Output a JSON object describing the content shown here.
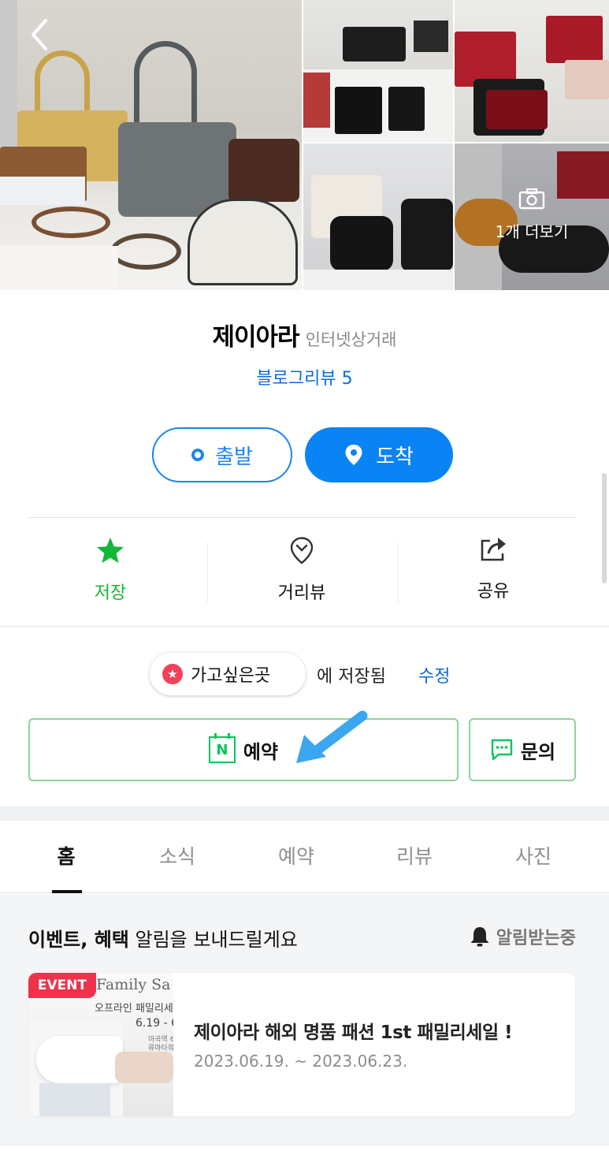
{
  "gallery": {
    "more_label": "1개 더보기"
  },
  "place": {
    "name": "제이아라",
    "category": "인터넷상거래",
    "blog_review": "블로그리뷰 5"
  },
  "route": {
    "depart_label": "출발",
    "arrive_label": "도착"
  },
  "actions": {
    "save_label": "저장",
    "street_view_label": "거리뷰",
    "share_label": "공유"
  },
  "saved": {
    "list_name": "가고싶은곳",
    "message": "에 저장됨",
    "edit_label": "수정"
  },
  "buttons": {
    "reserve_label": "예약",
    "inquiry_label": "문의"
  },
  "tabs": [
    "홈",
    "소식",
    "예약",
    "리뷰",
    "사진"
  ],
  "event_section": {
    "heading_bold": "이벤트, 혜택",
    "heading_rest": " 알림을 보내드릴게요",
    "notify_label": "알림받는중",
    "card": {
      "tag": "EVENT",
      "title": "제이아라 해외 명품 패션 1st 패밀리세일 !",
      "date": "2023.06.19. ~ 2023.06.23.",
      "thumb_script": "Family Sa",
      "thumb_line1": "오프라인 패밀리세",
      "thumb_line2": "6.19 - 6",
      "thumb_line3": "마곡역 6\n류마타워"
    }
  },
  "colors": {
    "accent_blue": "#0a84f5",
    "naver_green": "#03c75a",
    "event_red": "#f0314b"
  }
}
